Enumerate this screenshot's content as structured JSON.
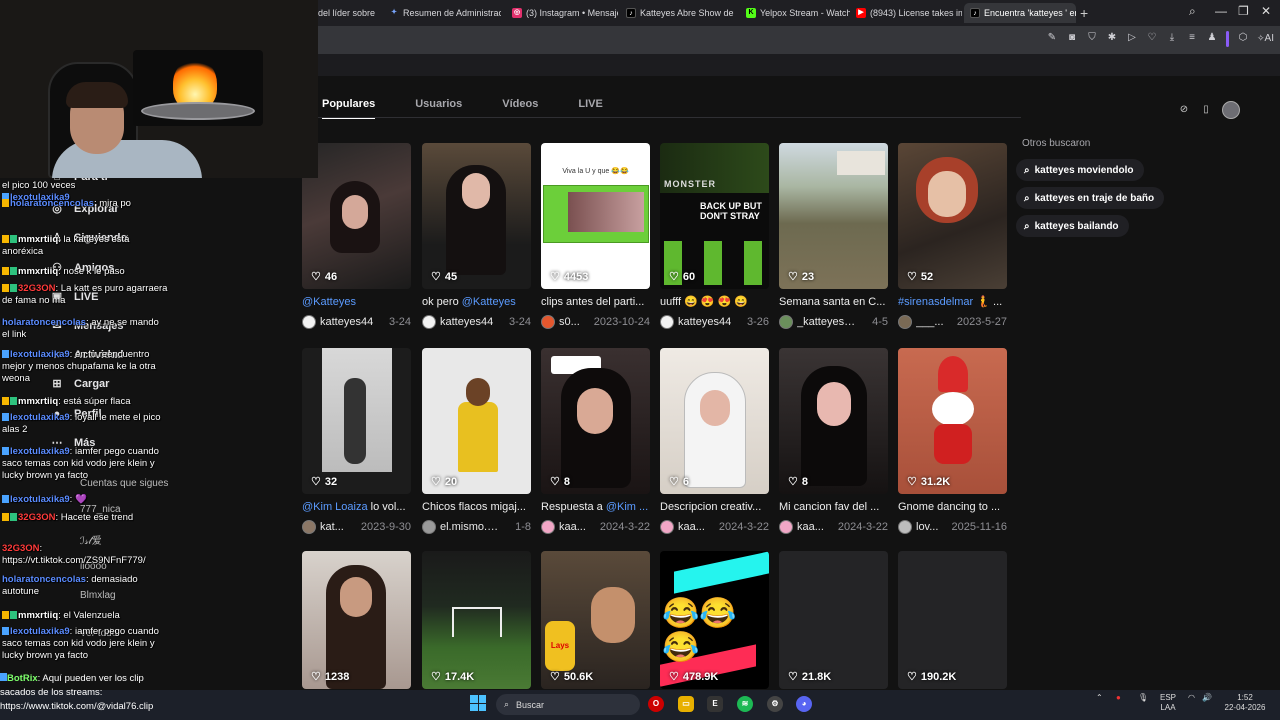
{
  "browser": {
    "tabs": [
      {
        "label": "del líder sobre la",
        "icon": "tab-page-icon",
        "color": "#3a3a3e"
      },
      {
        "label": "Resumen de Administració",
        "icon": "gemini-icon",
        "color": "#7aa7ff"
      },
      {
        "label": "(3) Instagram • Mensajes",
        "icon": "instagram-icon",
        "color": "#e1306c"
      },
      {
        "label": "Katteyes Abre Show de Ba",
        "icon": "tiktok-icon",
        "color": "#000000"
      },
      {
        "label": "Yelpox Stream - Watch Liv",
        "icon": "kick-icon",
        "color": "#53fc18"
      },
      {
        "label": "(8943) License takes impo",
        "icon": "youtube-icon",
        "color": "#ff0000"
      },
      {
        "label": "Encuentra 'katteyes ' en T",
        "icon": "tiktok-icon",
        "color": "#000000"
      }
    ],
    "ai_label": "AI"
  },
  "tiktok": {
    "search_tabs": [
      "Populares",
      "Usuarios",
      "Vídeos",
      "LIVE"
    ],
    "active_tab": "Populares",
    "nav": [
      {
        "label": "Para ti",
        "icon": "home-icon"
      },
      {
        "label": "Explorar",
        "icon": "compass-icon"
      },
      {
        "label": "Siguiendo",
        "icon": "following-icon"
      },
      {
        "label": "Amigos",
        "icon": "friends-icon"
      },
      {
        "label": "LIVE",
        "icon": "live-icon"
      },
      {
        "label": "Mensajes",
        "icon": "message-icon"
      },
      {
        "label": "Actividad",
        "icon": "bell-icon"
      },
      {
        "label": "Cargar",
        "icon": "upload-icon"
      },
      {
        "label": "Perfil",
        "icon": "profile-icon"
      },
      {
        "label": "Más",
        "icon": "more-icon"
      }
    ],
    "following_heading": "Cuentas que sigues",
    "following": [
      "777_nica",
      "ℐ𝓈𝓁爱",
      "lioooo",
      "Blmxlag",
      "Ver todo"
    ],
    "others_title": "Otros buscaron",
    "suggestions": [
      "katteyes moviendolo",
      "katteyes en traje de baño",
      "katteyes bailando"
    ],
    "videos": [
      {
        "likes": "46",
        "desc_mention": "@Katteyes",
        "desc": "",
        "user": "katteyes44",
        "date": "3-24",
        "avatar_color": "#f2f2f2"
      },
      {
        "likes": "45",
        "desc": "ok pero ",
        "desc_mention": "@Katteyes",
        "user": "katteyes44",
        "date": "3-24",
        "avatar_color": "#f2f2f2"
      },
      {
        "likes": "4453",
        "desc": "clips antes del parti...",
        "desc_mention": "",
        "user": "s0...",
        "date": "2023-10-24",
        "avatar_color": "#e4572e"
      },
      {
        "likes": "60",
        "desc": "uufff 😄 😍 😍 😄",
        "desc_mention": "",
        "user": "katteyes44",
        "date": "3-26",
        "avatar_color": "#f2f2f2"
      },
      {
        "likes": "23",
        "desc": "Semana santa en C...",
        "desc_mention": "",
        "user": "_katteyes_...",
        "date": "4-5",
        "avatar_color": "#6b8f5c"
      },
      {
        "likes": "52",
        "desc_mention": "#sirenasdelmar",
        "desc": " 🧜 ...",
        "user": "___...",
        "date": "2023-5-27",
        "avatar_color": "#7a6a55"
      },
      {
        "likes": "32",
        "desc_mention": "@Kim Loaiza",
        "desc": " lo vol...",
        "user": "kat...",
        "date": "2023-9-30",
        "avatar_color": "#8b7766"
      },
      {
        "likes": "20",
        "desc": "Chicos flacos migaj...",
        "desc_mention": "",
        "user": "el.mismo.p...",
        "date": "1-8",
        "avatar_color": "#9a9a9a"
      },
      {
        "likes": "8",
        "desc": "Respuesta a ",
        "desc_mention": "@Kim ...",
        "user": "kaa...",
        "date": "2024-3-22",
        "avatar_color": "#f1a7c6"
      },
      {
        "likes": "6",
        "desc": "Descripcion creativ...",
        "desc_mention": "",
        "user": "kaa...",
        "date": "2024-3-22",
        "avatar_color": "#f1a7c6"
      },
      {
        "likes": "8",
        "desc": "Mi cancion fav del ...",
        "desc_mention": "",
        "user": "kaa...",
        "date": "2024-3-22",
        "avatar_color": "#f1a7c6"
      },
      {
        "likes": "31.2K",
        "desc": "Gnome dancing to ...",
        "desc_mention": "",
        "user": "lov...",
        "date": "2025-11-16",
        "avatar_color": "#bdbdbd"
      },
      {
        "likes": "1238",
        "desc": "",
        "desc_mention": "",
        "user": "",
        "date": "",
        "avatar_color": ""
      },
      {
        "likes": "17.4K",
        "desc": "",
        "desc_mention": "",
        "user": "",
        "date": "",
        "avatar_color": ""
      },
      {
        "likes": "50.6K",
        "desc": "",
        "desc_mention": "",
        "user": "",
        "date": "",
        "avatar_color": ""
      },
      {
        "likes": "478.9K",
        "desc": "",
        "desc_mention": "",
        "user": "",
        "date": "",
        "avatar_color": ""
      },
      {
        "likes": "21.8K",
        "desc": "",
        "desc_mention": "",
        "user": "",
        "date": "",
        "avatar_color": ""
      },
      {
        "likes": "190.2K",
        "desc": "",
        "desc_mention": "",
        "user": "",
        "date": "",
        "avatar_color": ""
      }
    ],
    "thumb_texts": {
      "v3": "Viva la U y que 😂😂",
      "v4": "MONSTER",
      "v4b": "BACK UP BUT DON'T STRAY",
      "v15": "Lays"
    }
  },
  "chat": [
    {
      "user": "",
      "text": "el pico 100 veces",
      "color": "#ffffff"
    },
    {
      "user": "lexotulaxika9",
      "text": "mira po",
      "color": "#5b8cff"
    },
    {
      "user": "holaratoncencolas",
      "text": "mira po",
      "color": "#5b8cff"
    },
    {
      "user": "mmxrtiiq",
      "text": "la katteyes está anoréxica",
      "color": "#ffffff"
    },
    {
      "user": "mmxrtiiq",
      "text": "nose k le paso",
      "color": "#ffffff"
    },
    {
      "user": "32G3ON",
      "text": "La katt es puro agarraera de fama no ma",
      "color": "#ff3b3b"
    },
    {
      "user": "holaratoncencolas",
      "text": "ay ne se mando el link",
      "color": "#5b8cff"
    },
    {
      "user": "lexotulaxika9",
      "text": "en tu reencuentro mejor y menos chupafama ke la otra weona",
      "color": "#5b8cff"
    },
    {
      "user": "mmxrtiiq",
      "text": "está súper flaca",
      "color": "#ffffff"
    },
    {
      "user": "lexotulaxika9",
      "text": "loyall le mete el pico alas 2",
      "color": "#5b8cff"
    },
    {
      "user": "lexotulaxika9",
      "text": "iamfer pego cuando saco temas con kid vodo jere klein y lucky brown ya facto",
      "color": "#5b8cff"
    },
    {
      "user": "lexotulaxika9",
      "text": "",
      "color": "#5b8cff"
    },
    {
      "user": "32G3ON",
      "text": "Hacete ese trend",
      "color": "#ff3b3b"
    },
    {
      "user": "32G3ON",
      "text": "https://vt.tiktok.com/ZS9NFnF779/",
      "color": "#ff3b3b"
    },
    {
      "user": "holaratoncencolas",
      "text": "demasiado autotune",
      "color": "#5b8cff"
    },
    {
      "user": "mmxrtiiq",
      "text": "el Valenzuela",
      "color": "#ffffff"
    },
    {
      "user": "lexotulaxika9",
      "text": "iamfer pego cuando saco temas con kid vodo jere klein y lucky brown ya facto",
      "color": "#5b8cff"
    },
    {
      "user": "BotRix",
      "text": "Aquí pueden ver los clip sacados de los streams: https://www.tiktok.com/@vidal76.clip",
      "color": "#7dff6b"
    }
  ],
  "taskbar": {
    "search_placeholder": "Buscar",
    "lang_top": "ESP",
    "lang_bottom": "LAA",
    "time": "1:52",
    "date": "22-04-2026"
  }
}
